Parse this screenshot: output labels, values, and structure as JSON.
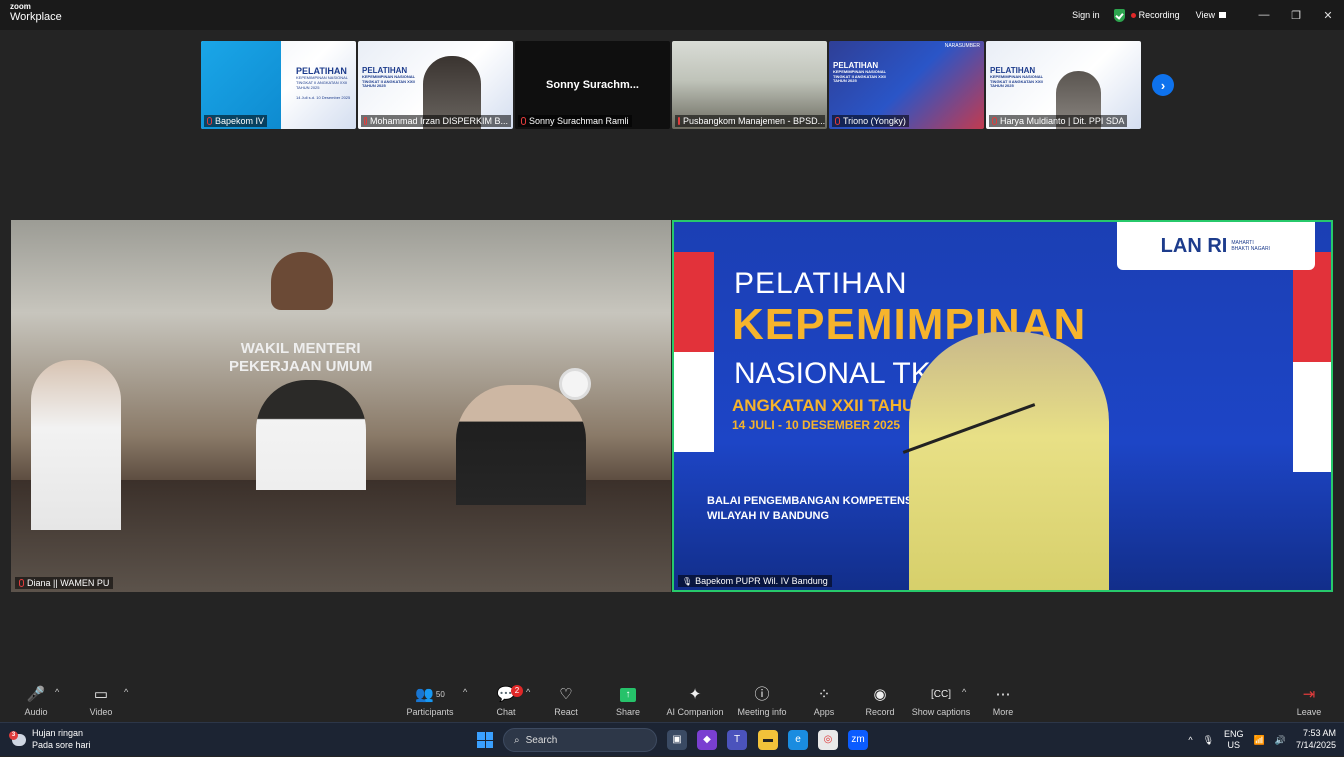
{
  "app": {
    "brand_top": "zoom",
    "brand_bottom": "Workplace"
  },
  "titlebar": {
    "sign_in": "Sign in",
    "recording": "Recording",
    "view": "View",
    "colors": {
      "shield": "#2da44e",
      "rec": "#e02828"
    }
  },
  "thumbnails": [
    {
      "name": "Bapekom IV",
      "slide_title": "PELATIHAN",
      "slide_sub": "KEPEMIMPINAN NASIONAL TINGKAT II ANGKATAN XXII TAHUN 2025",
      "slide_date": "14 Juli s.d. 10 Desember 2025"
    },
    {
      "name": "Mohammad Irzan DISPERKIM B...",
      "slide_title": "PELATIHAN",
      "slide_sub": "KEPEMIMPINAN NASIONAL TINGKAT II ANGKATAN XXII TAHUN 2025"
    },
    {
      "name": "Sonny Surachman Ramli",
      "center_name": "Sonny  Surachm..."
    },
    {
      "name": "Pusbangkom Manajemen - BPSD..."
    },
    {
      "name": "Triono (Yongky)",
      "slide_title": "PELATIHAN",
      "slide_sub": "KEPEMIMPINAN NASIONAL TINGKAT II ANGKATAN XXII TAHUN 2025",
      "slide_tag": "NARASUMBER"
    },
    {
      "name": "Harya Muldianto | Dit. PPI SDA",
      "slide_title": "PELATIHAN",
      "slide_sub": "KEPEMIMPINAN NASIONAL TINGKAT II ANGKATAN XXII TAHUN 2025"
    }
  ],
  "main": {
    "left": {
      "name": "Diana || WAMEN PU",
      "wall_text_1": "WAKIL MENTERI",
      "wall_text_2": "PEKERJAAN UMUM"
    },
    "right": {
      "name": "Bapekom PUPR Wil. IV Bandung",
      "logo": "LAN RI",
      "logo_sub": "MAHARTI BHAKTI NAGARI",
      "line1": "PELATIHAN",
      "line2": "KEPEMIMPINAN",
      "line3": "NASIONAL TK. II",
      "line4": "ANGKATAN XXII TAHUN 2025",
      "line5": "14 JULI - 10 DESEMBER 2025",
      "line6": "BALAI PENGEMBANGAN KOMPETENSI PU",
      "line7": "WILAYAH IV BANDUNG",
      "colors": {
        "active_border": "#27c96b",
        "slide_bg": "#1d45c6",
        "accent": "#f6b42c"
      }
    }
  },
  "toolbar": {
    "audio": "Audio",
    "video": "Video",
    "participants": "Participants",
    "participants_count": "50",
    "chat": "Chat",
    "chat_badge": "2",
    "react": "React",
    "share": "Share",
    "ai": "AI Companion",
    "info": "Meeting info",
    "apps": "Apps",
    "record": "Record",
    "captions": "Show captions",
    "more": "More",
    "leave": "Leave"
  },
  "taskbar": {
    "weather_title": "Hujan ringan",
    "weather_sub": "Pada sore hari",
    "weather_badge": "3",
    "search": "Search",
    "lang": "ENG",
    "region": "US",
    "time": "7:53 AM",
    "date": "7/14/2025"
  }
}
